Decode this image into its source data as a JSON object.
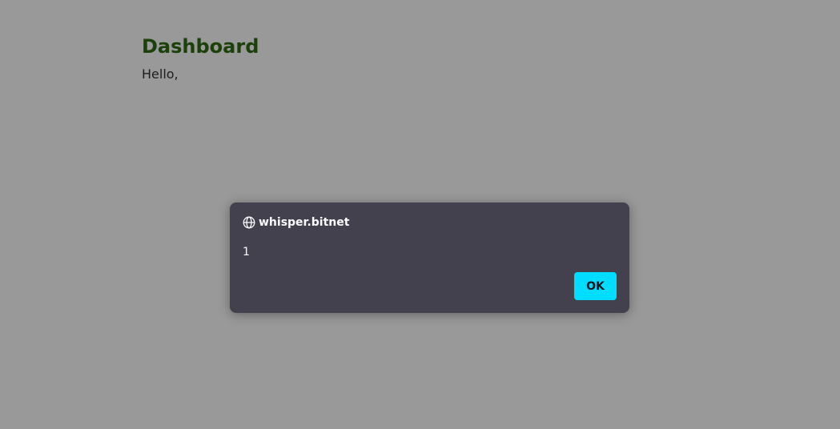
{
  "page": {
    "title": "Dashboard",
    "greeting": "Hello,"
  },
  "dialog": {
    "origin": "whisper.bitnet",
    "origin_icon": "globe-icon",
    "message": "1",
    "ok_label": "OK"
  },
  "colors": {
    "title": "#2f6b12",
    "dialog_background": "#42414d",
    "ok_button": "#00ddff"
  }
}
